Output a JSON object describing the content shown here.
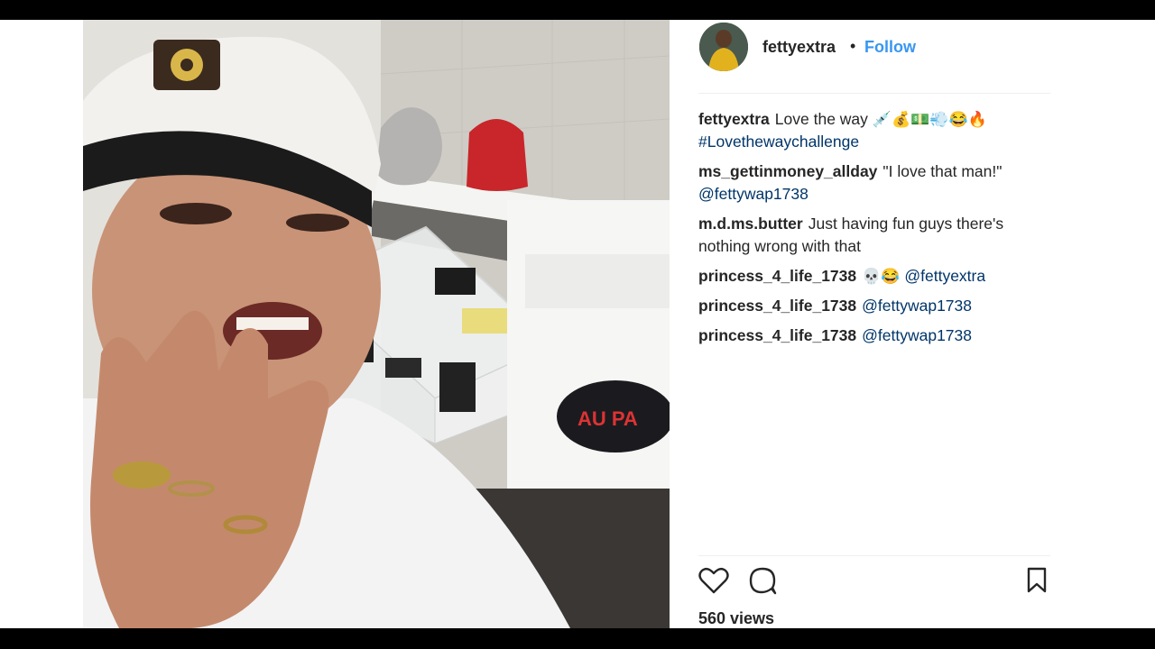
{
  "post": {
    "username": "fettyextra",
    "separator": "•",
    "follow_label": "Follow",
    "views": "560 views"
  },
  "media": {
    "bag_text": "AU PA"
  },
  "comments": [
    {
      "user": "fettyextra",
      "text": "Love the way ",
      "emoji": "💉💰💵💨😂🔥",
      "tag": "#Lovethewaychallenge"
    },
    {
      "user": "ms_gettinmoney_allday",
      "text": "\"I love that man!\" ",
      "tag": "@fettywap1738"
    },
    {
      "user": "m.d.ms.butter",
      "text": "Just having fun guys there's nothing wrong with that"
    },
    {
      "user": "princess_4_life_1738",
      "emoji": "💀😂",
      "tag": "@fettyextra"
    },
    {
      "user": "princess_4_life_1738",
      "tag": "@fettywap1738"
    },
    {
      "user": "princess_4_life_1738",
      "tag": "@fettywap1738"
    }
  ],
  "icons": [
    "heart-icon",
    "comment-icon",
    "bookmark-icon"
  ]
}
